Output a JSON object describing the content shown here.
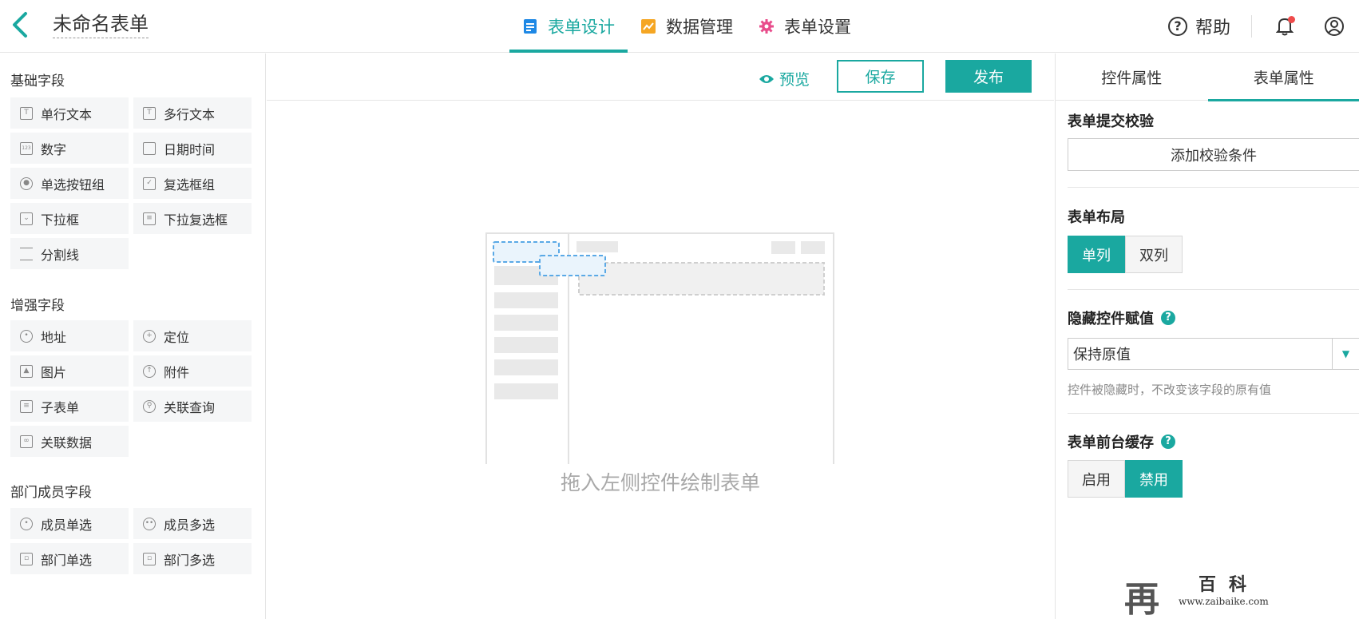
{
  "header": {
    "title": "未命名表单",
    "tabs": [
      {
        "label": "表单设计",
        "icon": "document-icon",
        "color": "#1e88e5"
      },
      {
        "label": "数据管理",
        "icon": "chart-icon",
        "color": "#f5a623"
      },
      {
        "label": "表单设置",
        "icon": "gear-icon",
        "color": "#e84c8b"
      }
    ],
    "help_label": "帮助",
    "help_glyph": "?"
  },
  "sidebar": {
    "groups": [
      {
        "title": "基础字段",
        "fields": [
          {
            "label": "单行文本",
            "icon": "text-icon"
          },
          {
            "label": "多行文本",
            "icon": "multiline-text-icon"
          },
          {
            "label": "数字",
            "icon": "number-icon"
          },
          {
            "label": "日期时间",
            "icon": "calendar-icon"
          },
          {
            "label": "单选按钮组",
            "icon": "radio-icon"
          },
          {
            "label": "复选框组",
            "icon": "checkbox-icon"
          },
          {
            "label": "下拉框",
            "icon": "dropdown-icon"
          },
          {
            "label": "下拉复选框",
            "icon": "dropdown-checklist-icon"
          },
          {
            "label": "分割线",
            "icon": "divider-icon"
          }
        ]
      },
      {
        "title": "增强字段",
        "fields": [
          {
            "label": "地址",
            "icon": "map-pin-icon"
          },
          {
            "label": "定位",
            "icon": "locate-icon"
          },
          {
            "label": "图片",
            "icon": "image-icon"
          },
          {
            "label": "附件",
            "icon": "upload-icon"
          },
          {
            "label": "子表单",
            "icon": "subform-icon"
          },
          {
            "label": "关联查询",
            "icon": "link-search-icon"
          },
          {
            "label": "关联数据",
            "icon": "link-data-icon"
          }
        ]
      },
      {
        "title": "部门成员字段",
        "fields": [
          {
            "label": "成员单选",
            "icon": "user-icon"
          },
          {
            "label": "成员多选",
            "icon": "users-icon"
          },
          {
            "label": "部门单选",
            "icon": "department-icon"
          },
          {
            "label": "部门多选",
            "icon": "departments-icon"
          }
        ]
      }
    ]
  },
  "canvas": {
    "preview_label": "预览",
    "save_label": "保存",
    "publish_label": "发布",
    "empty_tip": "拖入左侧控件绘制表单"
  },
  "props": {
    "tabs": [
      "控件属性",
      "表单属性"
    ],
    "active_tab": "表单属性",
    "submit_check": {
      "title": "表单提交校验",
      "button": "添加校验条件"
    },
    "layout": {
      "title": "表单布局",
      "options": [
        "单列",
        "双列"
      ],
      "selected": "单列"
    },
    "hidden_value": {
      "title": "隐藏控件赋值",
      "selected": "保持原值",
      "hint": "控件被隐藏时，不改变该字段的原有值"
    },
    "cache": {
      "title": "表单前台缓存",
      "options": [
        "启用",
        "禁用"
      ],
      "selected": "禁用"
    }
  },
  "watermark": {
    "text": "www.zaibaike.com",
    "glyph": "再",
    "word": "百科"
  },
  "colors": {
    "accent": "#1aa8a0"
  }
}
